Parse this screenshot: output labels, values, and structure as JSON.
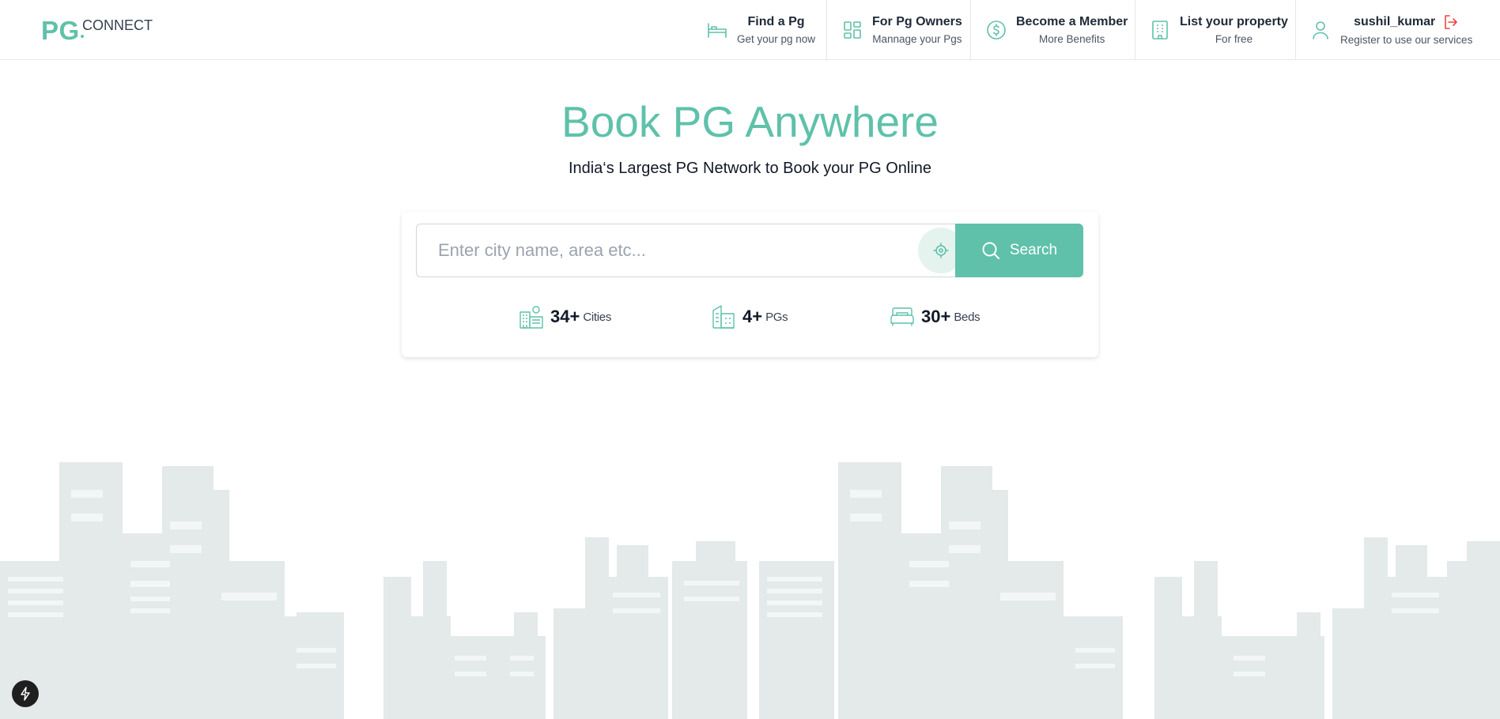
{
  "brand": {
    "logo_main": "PG",
    "logo_sub": "CONNECT"
  },
  "nav": [
    {
      "title": "Find a Pg",
      "subtitle": "Get your pg now",
      "icon": "bed-icon"
    },
    {
      "title": "For Pg Owners",
      "subtitle": "Mannage your Pgs",
      "icon": "dashboard-grid-icon"
    },
    {
      "title": "Become a Member",
      "subtitle": "More Benefits",
      "icon": "dollar-circle-icon"
    },
    {
      "title": "List your property",
      "subtitle": "For free",
      "icon": "building-icon"
    }
  ],
  "user": {
    "name": "sushil_kumar",
    "subtitle": "Register to use our services",
    "icon": "user-icon",
    "logout_icon": "logout-icon"
  },
  "hero": {
    "title": "Book PG Anywhere",
    "subtitle": "India‘s Largest PG Network to Book your PG Online"
  },
  "search": {
    "placeholder": "Enter city name, area etc...",
    "value": "",
    "button_label": "Search",
    "locate_icon": "crosshair-icon"
  },
  "stats": [
    {
      "value": "34+",
      "label": "Cities",
      "icon": "city-icon"
    },
    {
      "value": "4+",
      "label": "PGs",
      "icon": "house-icon"
    },
    {
      "value": "30+",
      "label": "Beds",
      "icon": "bed-icon"
    }
  ],
  "colors": {
    "accent": "#5fc1aa",
    "accent_light": "#e5f3ef",
    "logout": "#ef4444",
    "skyline": "#e3e8e8"
  }
}
